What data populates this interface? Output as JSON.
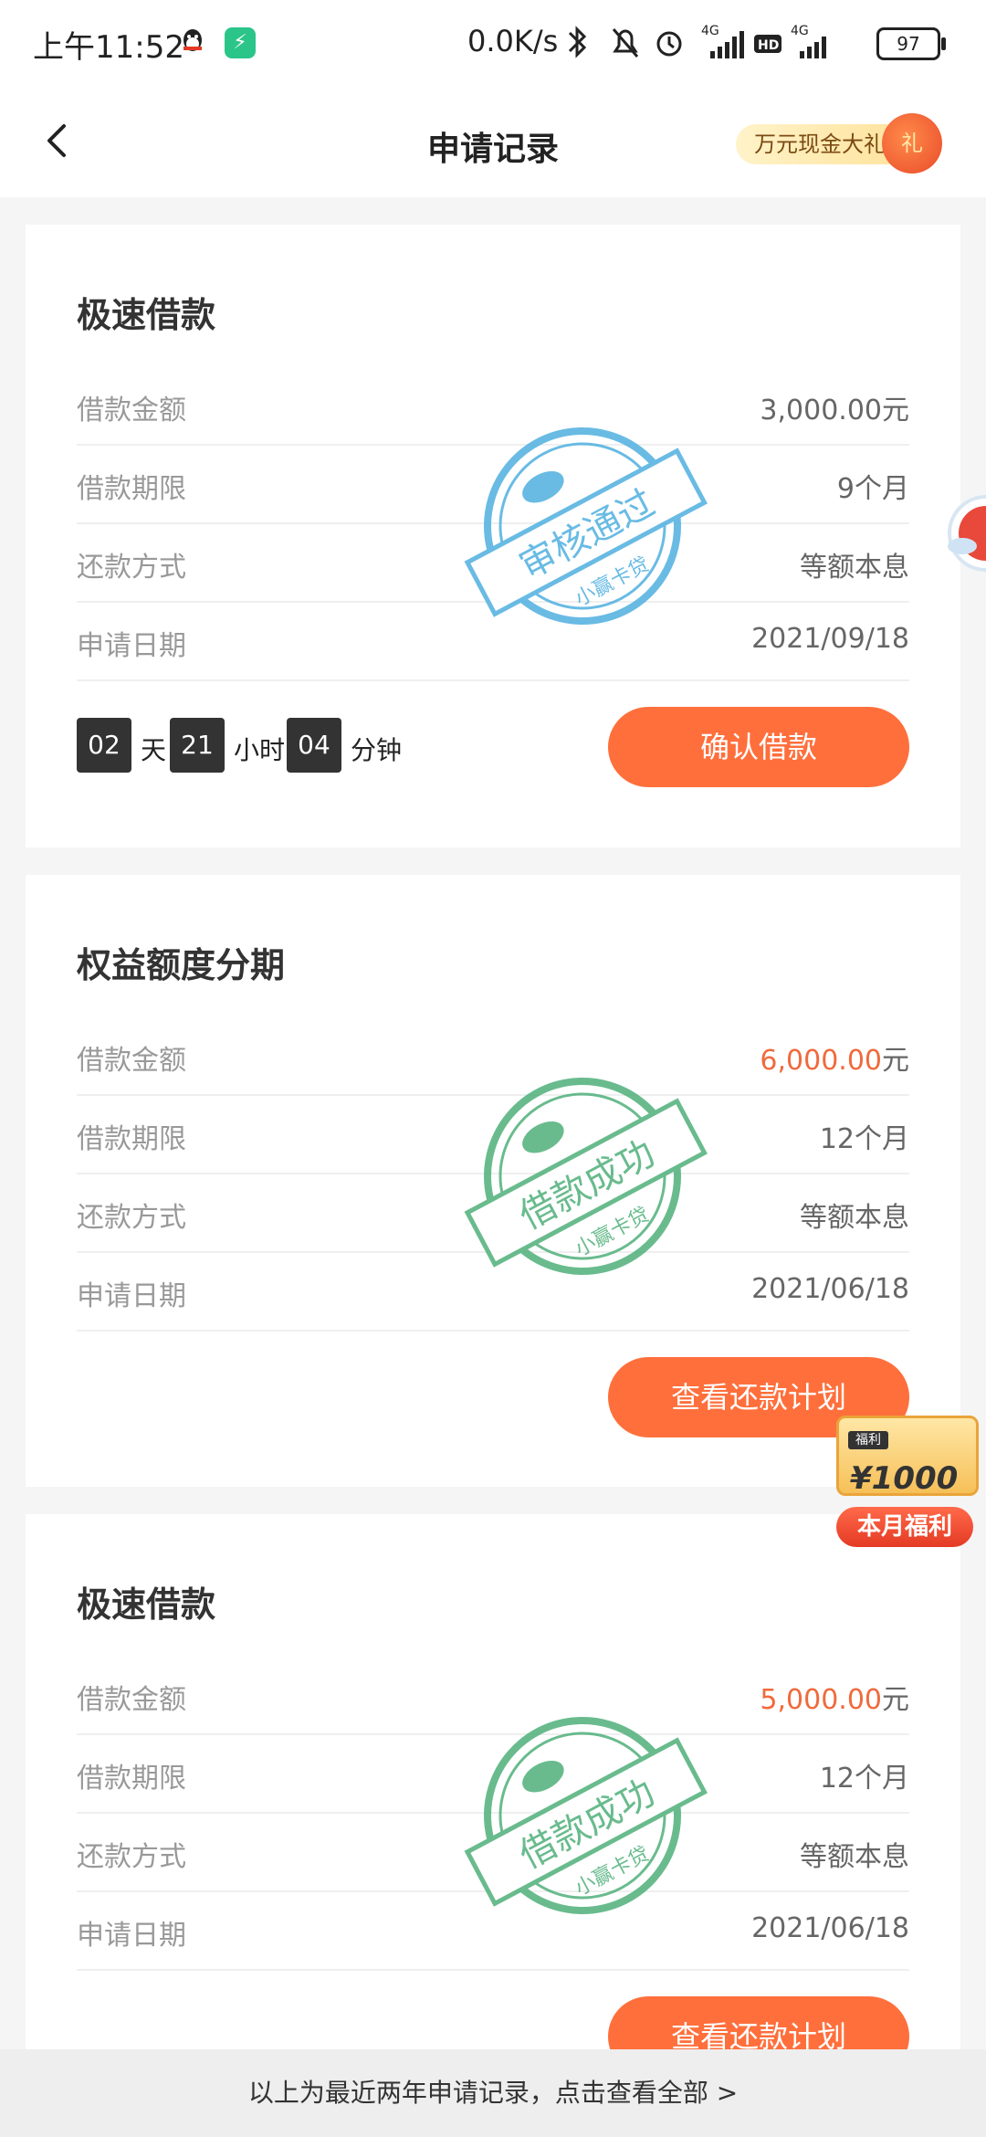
{
  "status_bar": {
    "time": "上午11:52",
    "speed": "0.0K/s",
    "network1": "4G",
    "hd": "HD",
    "network2": "4G",
    "battery": "97"
  },
  "nav": {
    "title": "申请记录",
    "promo": "万元现金大礼",
    "promo_badge": "礼"
  },
  "cards": [
    {
      "title": "极速借款",
      "rows": [
        {
          "label": "借款金额",
          "value": "3,000.00",
          "unit": "元",
          "highlight": false
        },
        {
          "label": "借款期限",
          "value": "9个月"
        },
        {
          "label": "还款方式",
          "value": "等额本息"
        },
        {
          "label": "申请日期",
          "value": "2021/09/18"
        }
      ],
      "stamp": {
        "text": "审核通过",
        "sub": "小赢卡贷",
        "color": "#4fb0e0"
      },
      "countdown": {
        "days": "02",
        "days_unit": "天",
        "hours": "21",
        "hours_unit": "小时",
        "minutes": "04",
        "minutes_unit": "分钟"
      },
      "button": "确认借款"
    },
    {
      "title": "权益额度分期",
      "rows": [
        {
          "label": "借款金额",
          "value": "6,000.00",
          "unit": "元",
          "highlight": true
        },
        {
          "label": "借款期限",
          "value": "12个月"
        },
        {
          "label": "还款方式",
          "value": "等额本息"
        },
        {
          "label": "申请日期",
          "value": "2021/06/18"
        }
      ],
      "stamp": {
        "text": "借款成功",
        "sub": "小赢卡贷",
        "color": "#4fb07a"
      },
      "button": "查看还款计划"
    },
    {
      "title": "极速借款",
      "rows": [
        {
          "label": "借款金额",
          "value": "5,000.00",
          "unit": "元",
          "highlight": true
        },
        {
          "label": "借款期限",
          "value": "12个月"
        },
        {
          "label": "还款方式",
          "value": "等额本息"
        },
        {
          "label": "申请日期",
          "value": "2021/06/18"
        }
      ],
      "stamp": {
        "text": "借款成功",
        "sub": "小赢卡贷",
        "color": "#4fb07a"
      },
      "button": "查看还款计划"
    }
  ],
  "gift": {
    "tag": "福利",
    "amount": "¥1000",
    "banner": "本月福利"
  },
  "footer": "以上为最近两年申请记录，点击查看全部 >",
  "colors": {
    "accent": "#ff6f3c",
    "amount_highlight": "#f06a3c",
    "stamp_blue": "#4fb0e0",
    "stamp_green": "#4fb07a"
  }
}
